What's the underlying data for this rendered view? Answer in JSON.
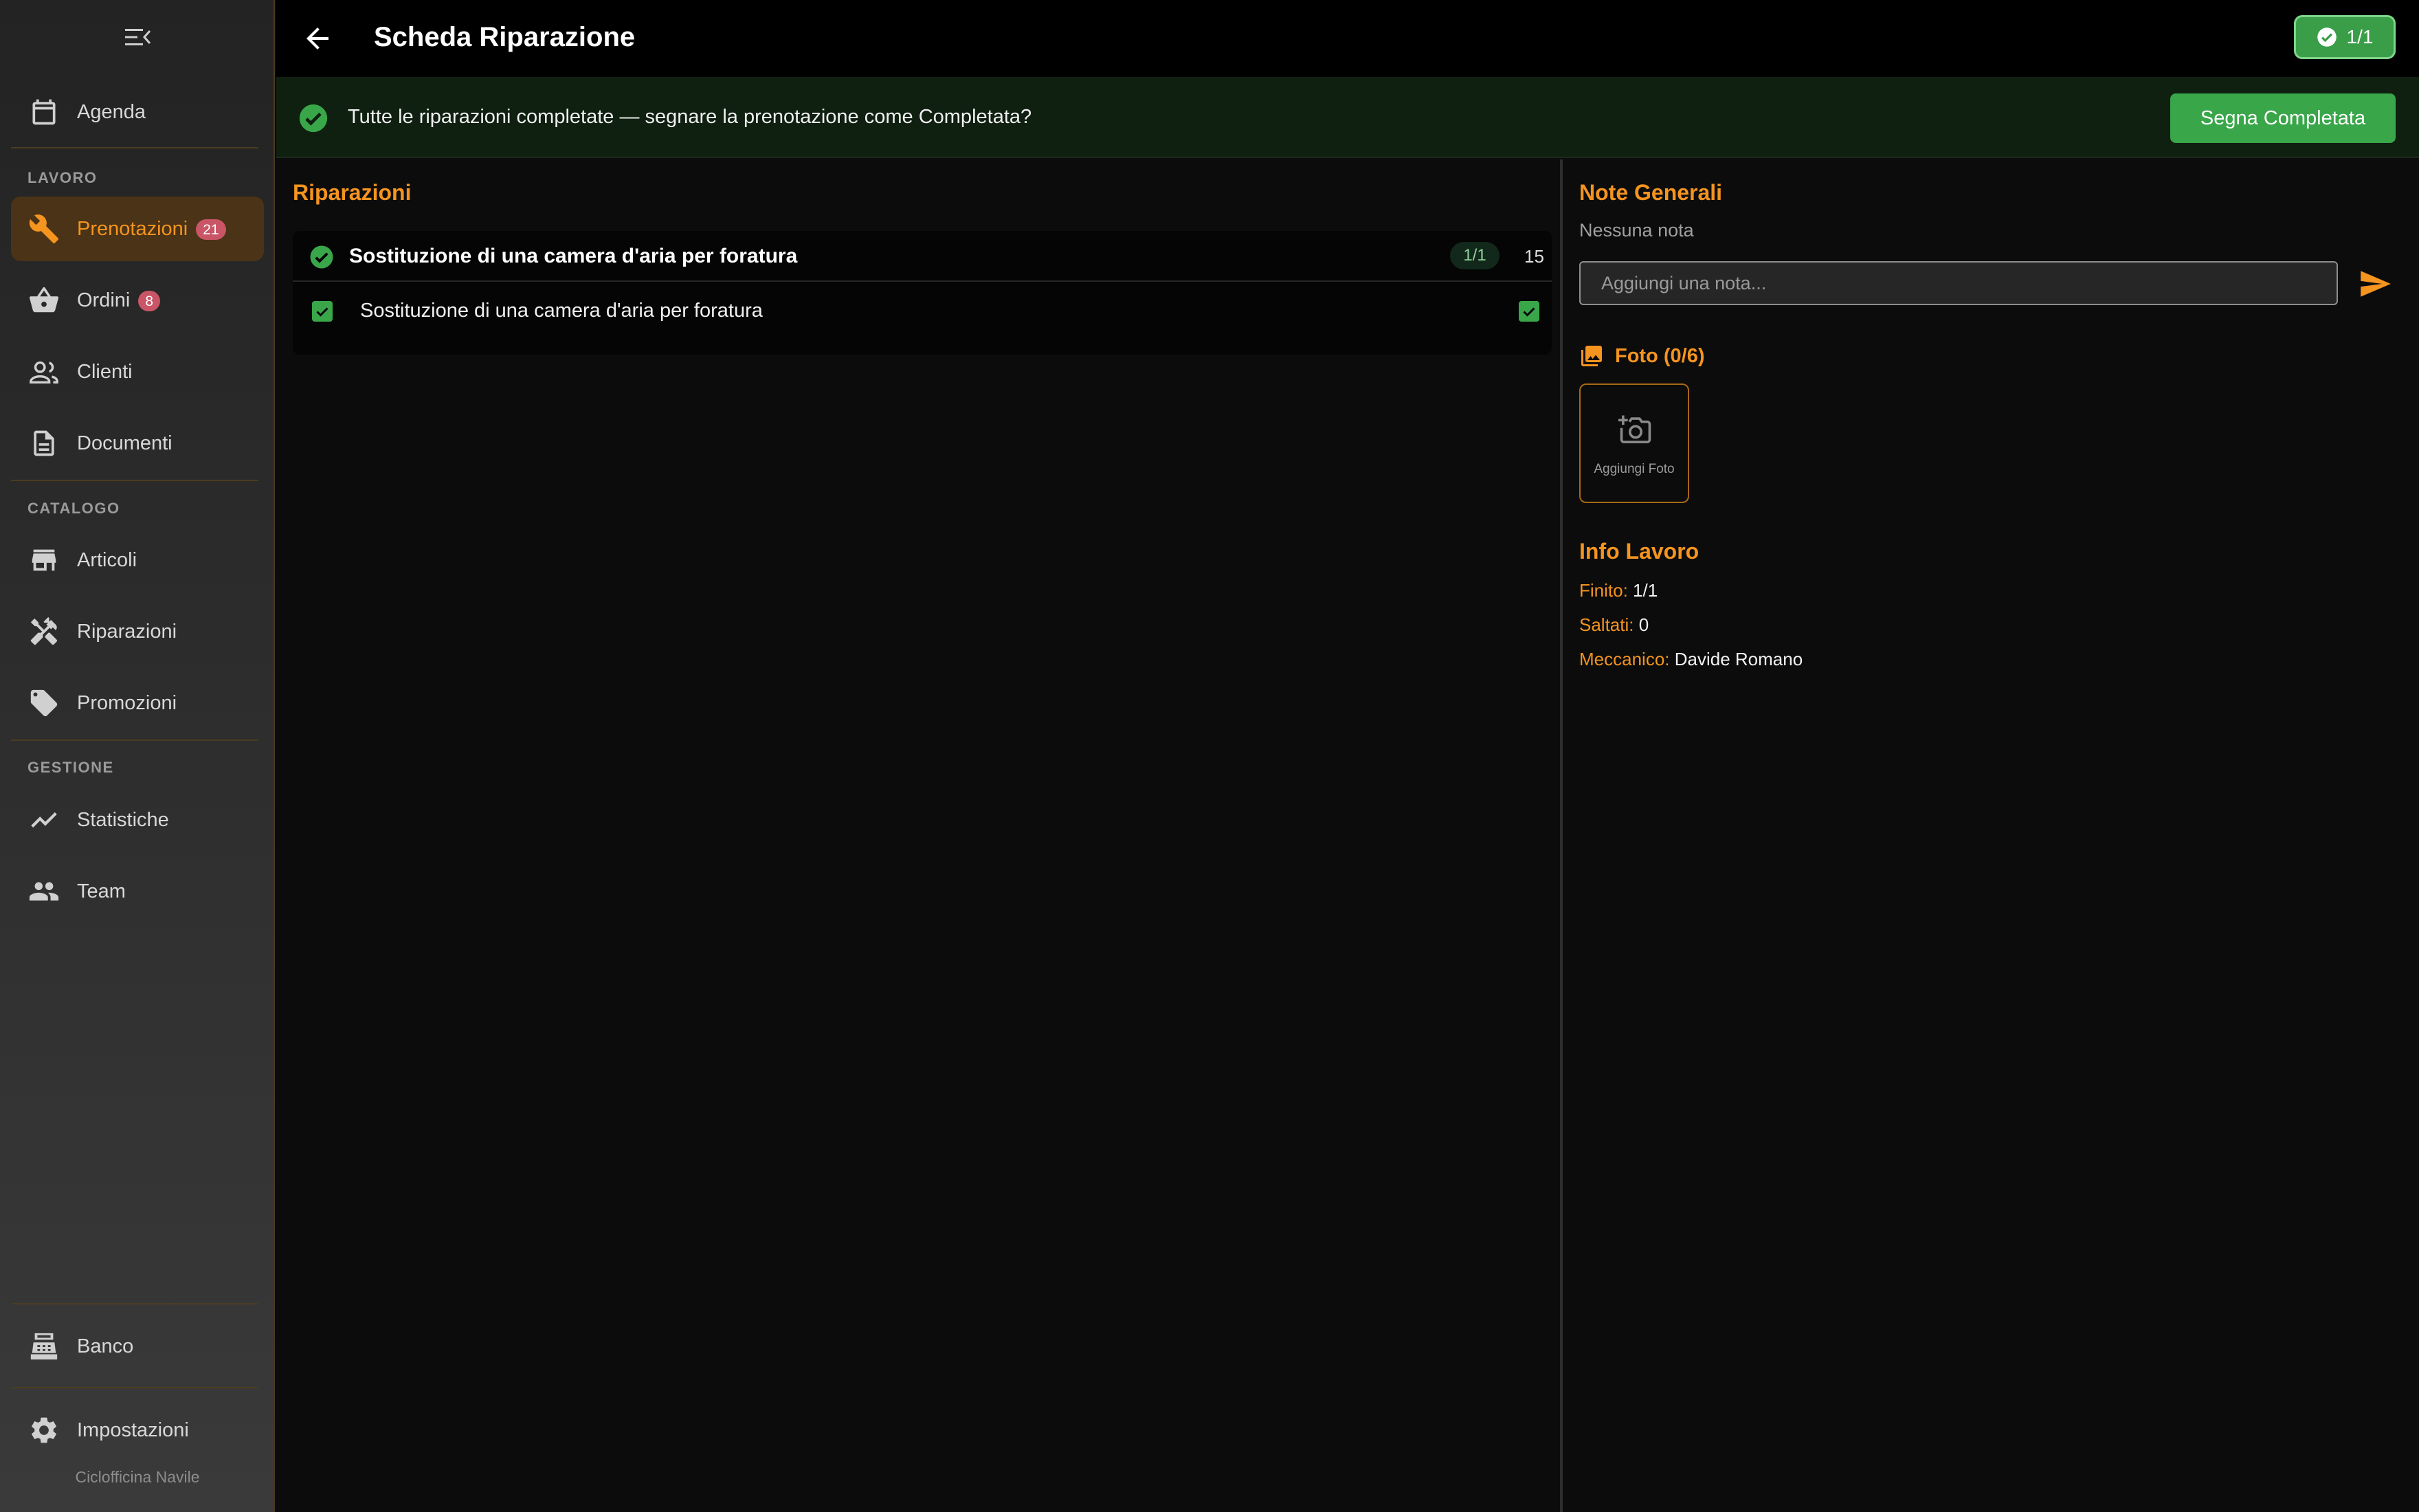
{
  "sidebar": {
    "items": {
      "agenda": {
        "label": "Agenda"
      },
      "prenotazioni": {
        "label": "Prenotazioni",
        "badge": "21"
      },
      "ordini": {
        "label": "Ordini",
        "badge": "8"
      },
      "clienti": {
        "label": "Clienti"
      },
      "documenti": {
        "label": "Documenti"
      },
      "articoli": {
        "label": "Articoli"
      },
      "riparazioni": {
        "label": "Riparazioni"
      },
      "promozioni": {
        "label": "Promozioni"
      },
      "statistiche": {
        "label": "Statistiche"
      },
      "team": {
        "label": "Team"
      },
      "banco": {
        "label": "Banco"
      },
      "impostazioni": {
        "label": "Impostazioni"
      }
    },
    "sections": {
      "lavoro": "LAVORO",
      "catalogo": "CATALOGO",
      "gestione": "GESTIONE"
    },
    "brand": "Ciclofficina Navile"
  },
  "header": {
    "title": "Scheda Riparazione",
    "status_chip": "1/1"
  },
  "banner": {
    "message": "Tutte le riparazioni completate — segnare la prenotazione come Completata?",
    "action_label": "Segna Completata"
  },
  "repairs": {
    "heading": "Riparazioni",
    "group": {
      "name": "Sostituzione di una camera d'aria per foratura",
      "progress": "1/1",
      "quantity": "15",
      "items": [
        {
          "label": "Sostituzione di una camera d'aria per foratura",
          "checked": true
        }
      ]
    }
  },
  "notes": {
    "heading": "Note Generali",
    "empty_text": "Nessuna nota",
    "input_placeholder": "Aggiungi una nota..."
  },
  "photos": {
    "heading": "Foto (0/6)",
    "add_label": "Aggiungi Foto"
  },
  "info": {
    "heading": "Info Lavoro",
    "finito_label": "Finito:",
    "finito_value": "1/1",
    "saltati_label": "Saltati:",
    "saltati_value": "0",
    "meccanico_label": "Meccanico:",
    "meccanico_value": "Davide Romano"
  },
  "colors": {
    "accent": "#f5941f",
    "success": "#3aa64a",
    "badge": "#c95567",
    "background": "#0b0b0b"
  },
  "icons": {
    "collapse": "menu-collapse-icon",
    "back": "arrow-left-icon",
    "check": "check-circle-icon",
    "send": "send-icon",
    "photo": "photo-library-icon",
    "camera": "add-camera-icon"
  }
}
